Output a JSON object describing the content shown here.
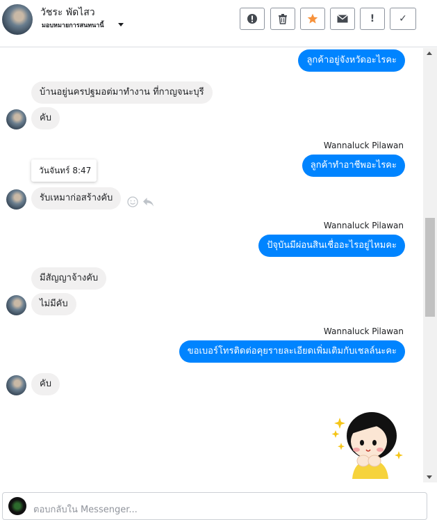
{
  "header": {
    "name": "วัชระ พัดไสว",
    "subtitle": "มอบหมายการสนทนานี้",
    "buttons": [
      {
        "icon": "alert-circle-icon",
        "glyph": "ⓘ"
      },
      {
        "icon": "trash-icon",
        "glyph": ""
      },
      {
        "icon": "star-icon",
        "glyph": "★"
      },
      {
        "icon": "envelope-icon",
        "glyph": "✉"
      },
      {
        "icon": "exclamation-icon",
        "glyph": "!"
      },
      {
        "icon": "check-icon",
        "glyph": "✓"
      }
    ]
  },
  "colors": {
    "outgoing_bubble": "#0084ff",
    "incoming_bubble": "#f1f0f0",
    "star": "#f7923b"
  },
  "messages": [
    {
      "dir": "out",
      "text": "ลูกค้าอยู่จังหวัดอะไรคะ"
    },
    {
      "dir": "in",
      "text": "บ้านอยู่นครปฐมอต่มาทำงาน ที่กาญจนะบุรี"
    },
    {
      "dir": "in",
      "text": "คับ"
    },
    {
      "dir": "out",
      "sender": "Wannaluck Pilawan",
      "text": "ลูกค้าทำอาชีพอะไรคะ"
    },
    {
      "dir": "in",
      "text": "รับเหมาก่อสร้างคับ",
      "tooltip": "วันจันทร์ 8:47"
    },
    {
      "dir": "out",
      "sender": "Wannaluck Pilawan",
      "text": "ปัจุบันมีผ่อนสินเชื่ออะไรอยู่ไหมคะ"
    },
    {
      "dir": "in",
      "text": "มีสัญญาจ้างคับ"
    },
    {
      "dir": "in",
      "text": "ไม่มีคับ"
    },
    {
      "dir": "out",
      "sender": "Wannaluck Pilawan",
      "text": "ขอเบอร์โทรติดต่อคุยรายละเอียดเพิ่มเติมกับเชลล์นะคะ"
    },
    {
      "dir": "in",
      "text": "คับ"
    },
    {
      "dir": "out",
      "sticker": "girl-sticker-icon"
    }
  ],
  "composer": {
    "placeholder": "ตอบกลับใน Messenger..."
  }
}
